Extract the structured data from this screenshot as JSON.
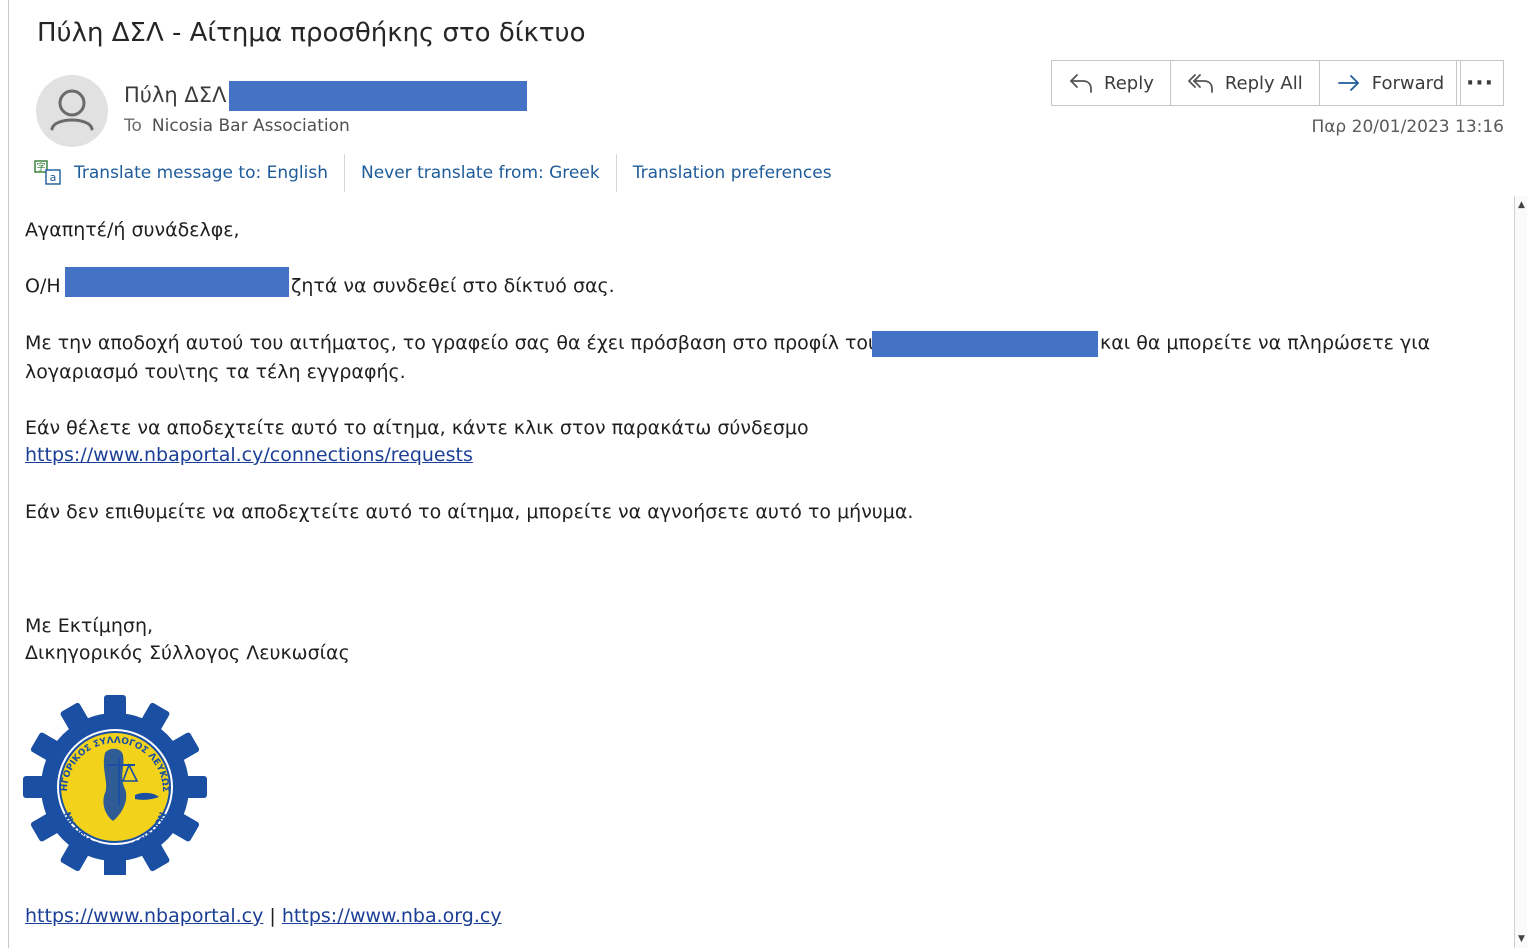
{
  "message": {
    "subject": "Πύλη ΔΣΛ - Αίτημα προσθήκης στο δίκτυο",
    "sender_name": "Πύλη ΔΣΛ",
    "to_label": "To",
    "to_value": "Nicosia Bar Association",
    "date": "Παρ 20/01/2023 13:16"
  },
  "actions": {
    "reply": "Reply",
    "reply_all": "Reply All",
    "forward": "Forward",
    "more": "···"
  },
  "translation": {
    "translate_to": "Translate message to: English",
    "never_translate": "Never translate from: Greek",
    "preferences": "Translation preferences"
  },
  "body": {
    "greeting": "Αγαπητέ/ή συνάδελφε,",
    "line1_prefix": "Ο/Η",
    "line1_suffix": "ζητά να συνδεθεί στο δίκτυό σας.",
    "line2_prefix": "Με την αποδοχή αυτού του αιτήματος, το γραφείο σας θα έχει πρόσβαση στο προφίλ του\\της",
    "line2_suffix": "και θα μπορείτε να πληρώσετε για",
    "line2_cont": "λογαριασμό του\\της τα τέλη εγγραφής.",
    "accept_text": "Εάν θέλετε να αποδεχτείτε αυτό το αίτημα, κάντε κλικ στον παρακάτω σύνδεσμο",
    "accept_link": "https://www.nbaportal.cy/connections/requests",
    "ignore_text": "Εάν δεν επιθυμείτε να αποδεχτείτε αυτό το αίτημα, μπορείτε να αγνοήσετε αυτό το μήνυμα.",
    "regards": "Με Εκτίμηση,",
    "signature": "Δικηγορικός Σύλλογος Λευκωσίας",
    "footer_link1": "https://www.nbaportal.cy",
    "footer_sep": "|",
    "footer_link2": "https://www.nba.org.cy"
  },
  "logo": {
    "text_top": "ΔΙΚΗΓΟΡΙΚΟΣ ΣΥΛΛΟΓΟΣ ΛΕΥΚΩΣΙΑΣ",
    "text_bottom": "NICOSIA BAR ASSOCIATION"
  },
  "colors": {
    "redaction": "#4472c4",
    "link": "#1b3f96",
    "translate_link": "#1d5b9a",
    "logo_blue": "#1a4fa3",
    "logo_yellow": "#f2d21b"
  }
}
